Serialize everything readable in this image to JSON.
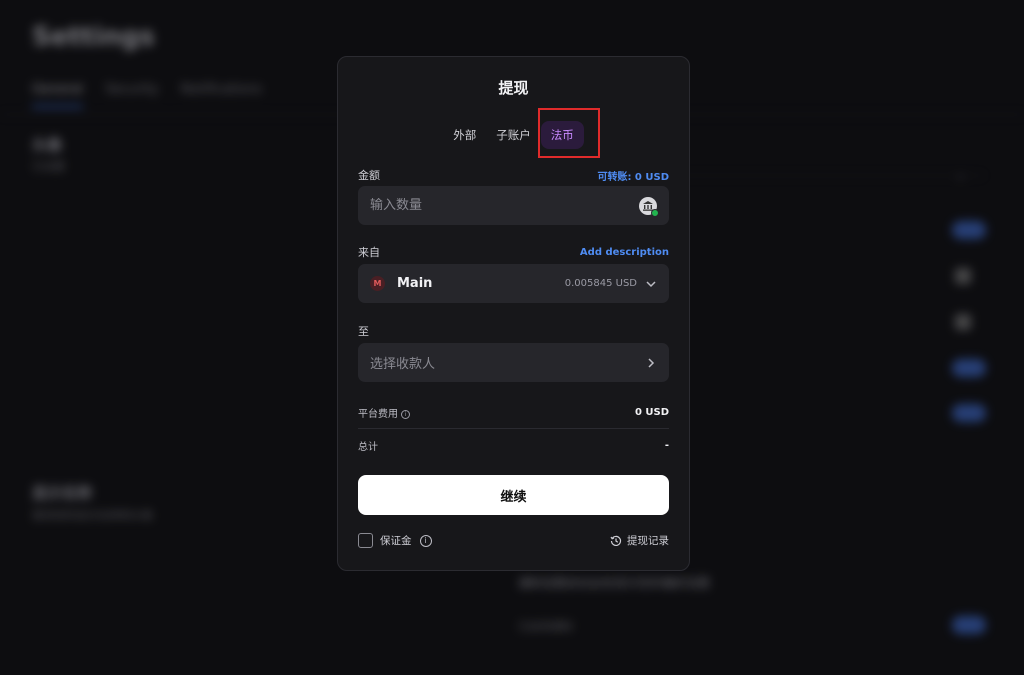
{
  "background": {
    "title": "Settings",
    "tabs": [
      "General",
      "Security",
      "Notifications"
    ],
    "section_title": "头像",
    "section_sub": "已设置",
    "section2_title": "显示名称",
    "section2_sub": "更改您的显示名称和头像",
    "section3_text": "通知设置会在此处显示您的偏好设置",
    "section4_text": "已启用通知"
  },
  "modal": {
    "title": "提现",
    "tabs": [
      {
        "label": "外部",
        "active": false
      },
      {
        "label": "子账户",
        "active": false
      },
      {
        "label": "法币",
        "active": true
      }
    ],
    "amount": {
      "label": "金额",
      "transferable": "可转账: 0 USD",
      "placeholder": "输入数量",
      "icon": "bank-icon"
    },
    "from": {
      "label": "来自",
      "add_description": "Add description",
      "account_initial": "M",
      "account_name": "Main",
      "balance": "0.005845 USD",
      "icon": "chevron-down-icon"
    },
    "to": {
      "label": "至",
      "placeholder": "选择收款人",
      "icon": "chevron-right-icon"
    },
    "fee": {
      "label": "平台费用",
      "value": "0 USD"
    },
    "total": {
      "label": "总计",
      "value": "-"
    },
    "continue_label": "继续",
    "deposit_label": "保证金",
    "history_label": "提现记录"
  },
  "colors": {
    "accent_purple": "#c889ff",
    "link_blue": "#4f8cf2",
    "highlight_red": "#e02b2b"
  }
}
